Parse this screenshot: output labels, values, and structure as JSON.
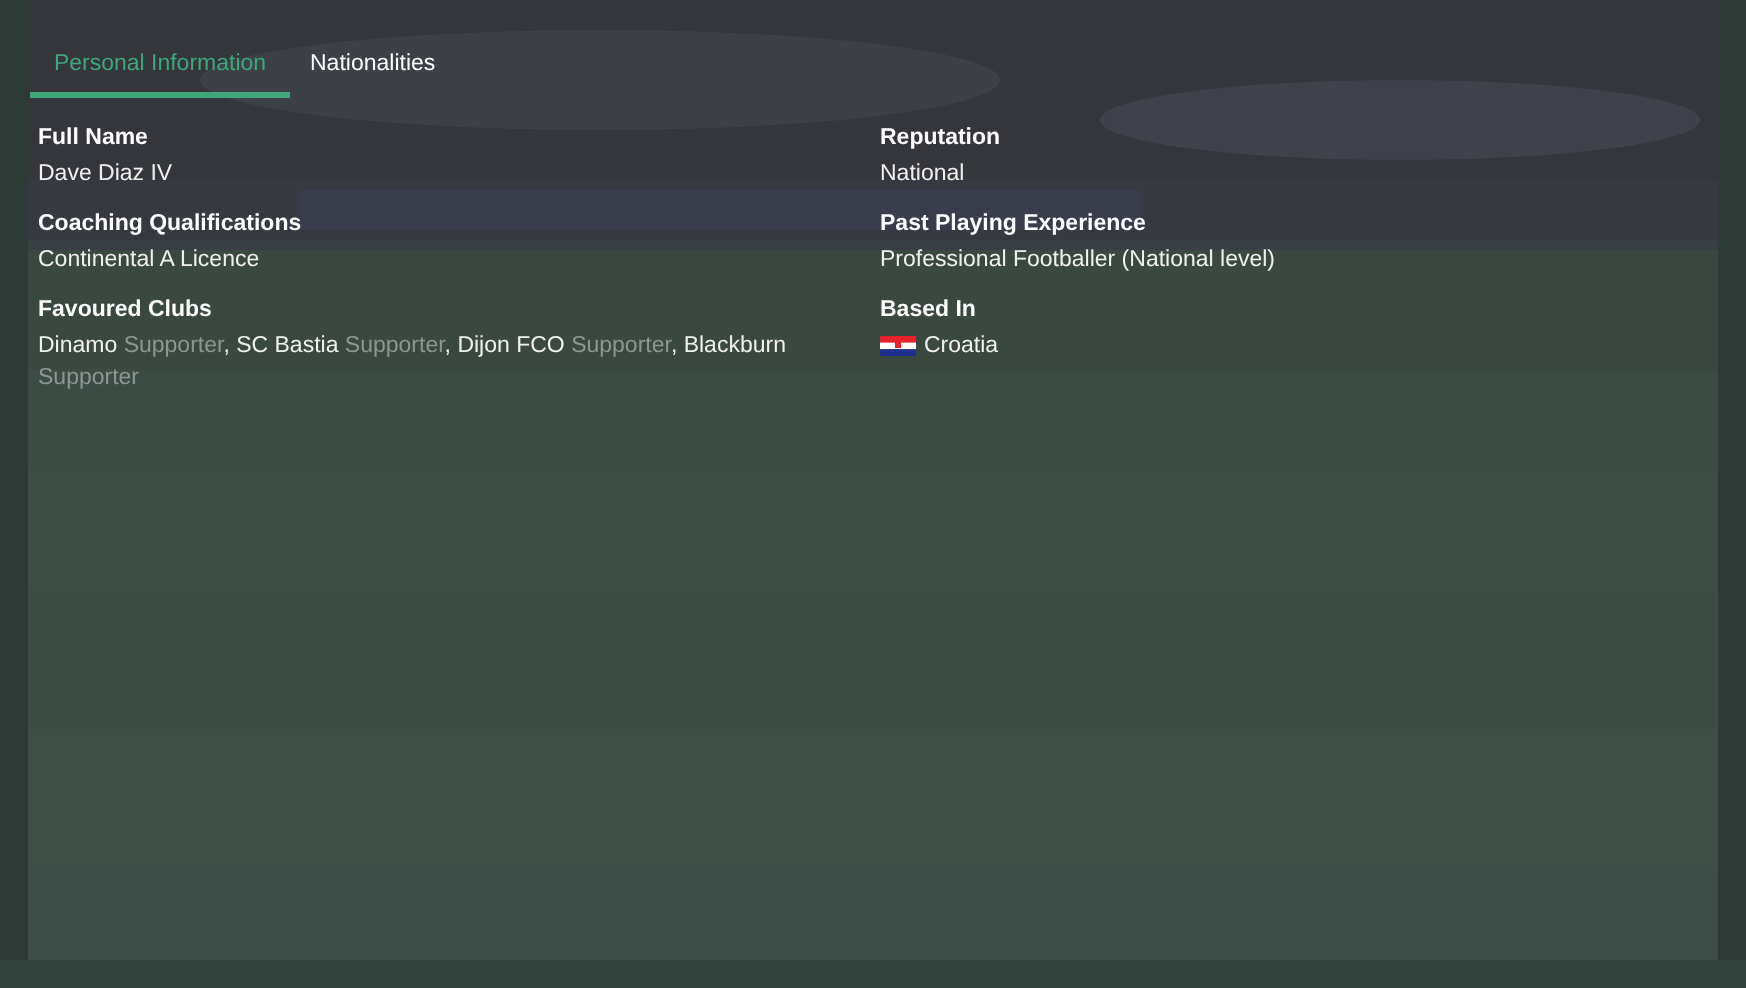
{
  "tabs": [
    {
      "label": "Personal Information",
      "selected": true
    },
    {
      "label": "Nationalities",
      "selected": false
    }
  ],
  "left_fields": [
    {
      "label": "Full Name",
      "value": "Dave Diaz IV"
    },
    {
      "label": "Coaching Qualifications",
      "value": "Continental A Licence"
    },
    {
      "label": "Favoured Clubs",
      "clubs": [
        {
          "club": "Dinamo",
          "role": "Supporter",
          "separator": ","
        },
        {
          "club": "SC Bastia",
          "role": "Supporter",
          "separator": ","
        },
        {
          "club": "Dijon FCO",
          "role": "Supporter",
          "separator": ","
        },
        {
          "club": "Blackburn",
          "role": "Supporter"
        }
      ]
    }
  ],
  "right_fields": [
    {
      "label": "Reputation",
      "value": "National"
    },
    {
      "label": "Past Playing Experience",
      "value": "Professional Footballer (National level)"
    },
    {
      "label": "Based In",
      "value": "Croatia",
      "flag": true
    }
  ]
}
